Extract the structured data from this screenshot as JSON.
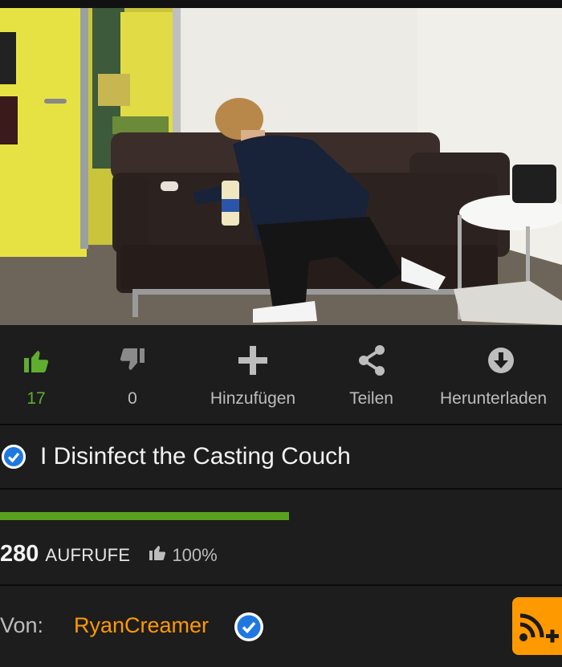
{
  "video": {
    "thumbnail_icon": "video-thumbnail-office-couch"
  },
  "actions": {
    "like": {
      "icon": "thumbs-up-icon",
      "count": "17",
      "color": "#5fae2f"
    },
    "dislike": {
      "icon": "thumbs-down-icon",
      "count": "0"
    },
    "add": {
      "icon": "plus-icon",
      "label": "Hinzufügen"
    },
    "share": {
      "icon": "share-icon",
      "label": "Teilen"
    },
    "download": {
      "icon": "download-icon",
      "label": "Herunterladen"
    }
  },
  "title": {
    "verified_icon": "verified-check-icon",
    "text": "I Disinfect the Casting Couch"
  },
  "stats": {
    "views_count": "280",
    "views_label": "AUFRUFE",
    "rating_icon": "thumbs-up-icon",
    "rating_percent": "100%",
    "rating_fraction": 1.0,
    "rating_color": "#5aa01f"
  },
  "uploader": {
    "prefix": "Von:",
    "name": "RyanCreamer",
    "name_color": "#ff9900",
    "verified_icon": "verified-check-icon",
    "subscribe_icon": "rss-subscribe-icon"
  }
}
